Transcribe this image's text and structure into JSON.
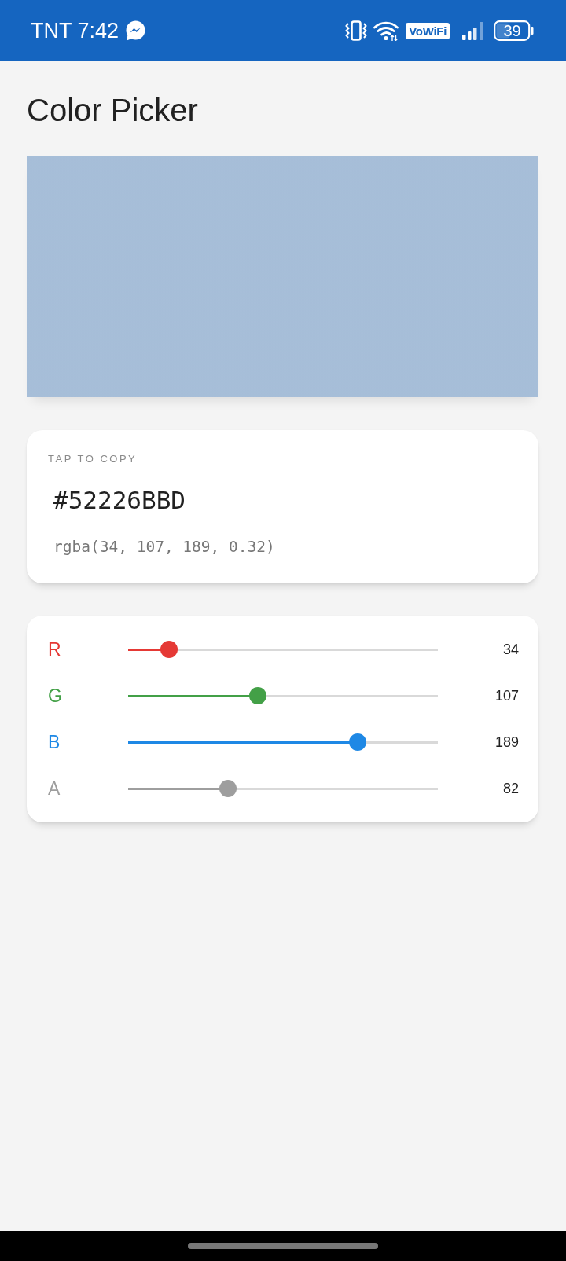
{
  "status_bar": {
    "carrier": "TNT",
    "time": "7:42",
    "vowifi": "VoWiFi",
    "battery": "39"
  },
  "title": "Color Picker",
  "code_card": {
    "hint": "TAP TO COPY",
    "hex": "#52226BBD",
    "rgba": "rgba(34, 107, 189, 0.32)"
  },
  "channels": [
    {
      "label": "R",
      "color": "#e53935",
      "level": 0.133,
      "value": "34"
    },
    {
      "label": "G",
      "color": "#43a047",
      "level": 0.42,
      "value": "107"
    },
    {
      "label": "B",
      "color": "#1e88e5",
      "level": 0.741,
      "value": "189"
    },
    {
      "label": "A",
      "color": "#9e9e9e",
      "level": 0.322,
      "value": "82"
    }
  ]
}
